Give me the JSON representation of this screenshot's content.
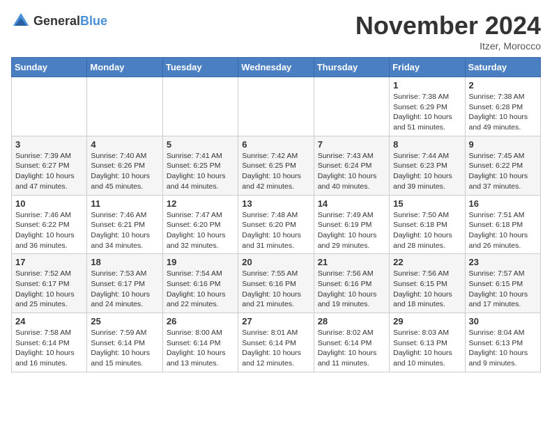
{
  "header": {
    "logo_general": "General",
    "logo_blue": "Blue",
    "title": "November 2024",
    "location": "Itzer, Morocco"
  },
  "weekdays": [
    "Sunday",
    "Monday",
    "Tuesday",
    "Wednesday",
    "Thursday",
    "Friday",
    "Saturday"
  ],
  "weeks": [
    [
      {
        "day": "",
        "sunrise": "",
        "sunset": "",
        "daylight": ""
      },
      {
        "day": "",
        "sunrise": "",
        "sunset": "",
        "daylight": ""
      },
      {
        "day": "",
        "sunrise": "",
        "sunset": "",
        "daylight": ""
      },
      {
        "day": "",
        "sunrise": "",
        "sunset": "",
        "daylight": ""
      },
      {
        "day": "",
        "sunrise": "",
        "sunset": "",
        "daylight": ""
      },
      {
        "day": "1",
        "sunrise": "Sunrise: 7:38 AM",
        "sunset": "Sunset: 6:29 PM",
        "daylight": "Daylight: 10 hours and 51 minutes."
      },
      {
        "day": "2",
        "sunrise": "Sunrise: 7:38 AM",
        "sunset": "Sunset: 6:28 PM",
        "daylight": "Daylight: 10 hours and 49 minutes."
      }
    ],
    [
      {
        "day": "3",
        "sunrise": "Sunrise: 7:39 AM",
        "sunset": "Sunset: 6:27 PM",
        "daylight": "Daylight: 10 hours and 47 minutes."
      },
      {
        "day": "4",
        "sunrise": "Sunrise: 7:40 AM",
        "sunset": "Sunset: 6:26 PM",
        "daylight": "Daylight: 10 hours and 45 minutes."
      },
      {
        "day": "5",
        "sunrise": "Sunrise: 7:41 AM",
        "sunset": "Sunset: 6:25 PM",
        "daylight": "Daylight: 10 hours and 44 minutes."
      },
      {
        "day": "6",
        "sunrise": "Sunrise: 7:42 AM",
        "sunset": "Sunset: 6:25 PM",
        "daylight": "Daylight: 10 hours and 42 minutes."
      },
      {
        "day": "7",
        "sunrise": "Sunrise: 7:43 AM",
        "sunset": "Sunset: 6:24 PM",
        "daylight": "Daylight: 10 hours and 40 minutes."
      },
      {
        "day": "8",
        "sunrise": "Sunrise: 7:44 AM",
        "sunset": "Sunset: 6:23 PM",
        "daylight": "Daylight: 10 hours and 39 minutes."
      },
      {
        "day": "9",
        "sunrise": "Sunrise: 7:45 AM",
        "sunset": "Sunset: 6:22 PM",
        "daylight": "Daylight: 10 hours and 37 minutes."
      }
    ],
    [
      {
        "day": "10",
        "sunrise": "Sunrise: 7:46 AM",
        "sunset": "Sunset: 6:22 PM",
        "daylight": "Daylight: 10 hours and 36 minutes."
      },
      {
        "day": "11",
        "sunrise": "Sunrise: 7:46 AM",
        "sunset": "Sunset: 6:21 PM",
        "daylight": "Daylight: 10 hours and 34 minutes."
      },
      {
        "day": "12",
        "sunrise": "Sunrise: 7:47 AM",
        "sunset": "Sunset: 6:20 PM",
        "daylight": "Daylight: 10 hours and 32 minutes."
      },
      {
        "day": "13",
        "sunrise": "Sunrise: 7:48 AM",
        "sunset": "Sunset: 6:20 PM",
        "daylight": "Daylight: 10 hours and 31 minutes."
      },
      {
        "day": "14",
        "sunrise": "Sunrise: 7:49 AM",
        "sunset": "Sunset: 6:19 PM",
        "daylight": "Daylight: 10 hours and 29 minutes."
      },
      {
        "day": "15",
        "sunrise": "Sunrise: 7:50 AM",
        "sunset": "Sunset: 6:18 PM",
        "daylight": "Daylight: 10 hours and 28 minutes."
      },
      {
        "day": "16",
        "sunrise": "Sunrise: 7:51 AM",
        "sunset": "Sunset: 6:18 PM",
        "daylight": "Daylight: 10 hours and 26 minutes."
      }
    ],
    [
      {
        "day": "17",
        "sunrise": "Sunrise: 7:52 AM",
        "sunset": "Sunset: 6:17 PM",
        "daylight": "Daylight: 10 hours and 25 minutes."
      },
      {
        "day": "18",
        "sunrise": "Sunrise: 7:53 AM",
        "sunset": "Sunset: 6:17 PM",
        "daylight": "Daylight: 10 hours and 24 minutes."
      },
      {
        "day": "19",
        "sunrise": "Sunrise: 7:54 AM",
        "sunset": "Sunset: 6:16 PM",
        "daylight": "Daylight: 10 hours and 22 minutes."
      },
      {
        "day": "20",
        "sunrise": "Sunrise: 7:55 AM",
        "sunset": "Sunset: 6:16 PM",
        "daylight": "Daylight: 10 hours and 21 minutes."
      },
      {
        "day": "21",
        "sunrise": "Sunrise: 7:56 AM",
        "sunset": "Sunset: 6:16 PM",
        "daylight": "Daylight: 10 hours and 19 minutes."
      },
      {
        "day": "22",
        "sunrise": "Sunrise: 7:56 AM",
        "sunset": "Sunset: 6:15 PM",
        "daylight": "Daylight: 10 hours and 18 minutes."
      },
      {
        "day": "23",
        "sunrise": "Sunrise: 7:57 AM",
        "sunset": "Sunset: 6:15 PM",
        "daylight": "Daylight: 10 hours and 17 minutes."
      }
    ],
    [
      {
        "day": "24",
        "sunrise": "Sunrise: 7:58 AM",
        "sunset": "Sunset: 6:14 PM",
        "daylight": "Daylight: 10 hours and 16 minutes."
      },
      {
        "day": "25",
        "sunrise": "Sunrise: 7:59 AM",
        "sunset": "Sunset: 6:14 PM",
        "daylight": "Daylight: 10 hours and 15 minutes."
      },
      {
        "day": "26",
        "sunrise": "Sunrise: 8:00 AM",
        "sunset": "Sunset: 6:14 PM",
        "daylight": "Daylight: 10 hours and 13 minutes."
      },
      {
        "day": "27",
        "sunrise": "Sunrise: 8:01 AM",
        "sunset": "Sunset: 6:14 PM",
        "daylight": "Daylight: 10 hours and 12 minutes."
      },
      {
        "day": "28",
        "sunrise": "Sunrise: 8:02 AM",
        "sunset": "Sunset: 6:14 PM",
        "daylight": "Daylight: 10 hours and 11 minutes."
      },
      {
        "day": "29",
        "sunrise": "Sunrise: 8:03 AM",
        "sunset": "Sunset: 6:13 PM",
        "daylight": "Daylight: 10 hours and 10 minutes."
      },
      {
        "day": "30",
        "sunrise": "Sunrise: 8:04 AM",
        "sunset": "Sunset: 6:13 PM",
        "daylight": "Daylight: 10 hours and 9 minutes."
      }
    ]
  ]
}
